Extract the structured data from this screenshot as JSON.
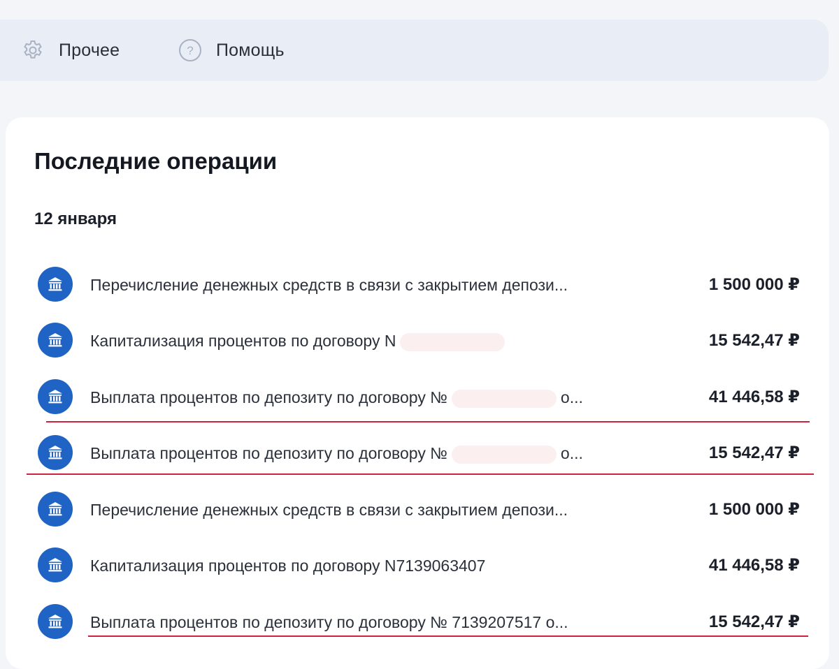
{
  "nav": {
    "other_label": "Прочее",
    "help_label": "Помощь",
    "icons": {
      "other": "gear-icon",
      "help": "help-circle-icon"
    }
  },
  "section": {
    "title": "Последние операции",
    "date": "12 января"
  },
  "operations": [
    {
      "prefix": "Перечисление денежных средств в связи с закрытием депози...",
      "suffix": "",
      "amount": "1 500 000 ₽",
      "redacted": false
    },
    {
      "prefix": "Капитализация процентов по договору N",
      "suffix": "",
      "amount": "15 542,47 ₽",
      "redacted": true
    },
    {
      "prefix": "Выплата процентов по депозиту по договору №",
      "suffix": "о...",
      "amount": "41 446,58 ₽",
      "redacted": true
    },
    {
      "prefix": "Выплата процентов по депозиту по договору №",
      "suffix": "о...",
      "amount": "15 542,47 ₽",
      "redacted": true
    },
    {
      "prefix": "Перечисление денежных средств в связи с закрытием депози...",
      "suffix": "",
      "amount": "1 500 000 ₽",
      "redacted": false
    },
    {
      "prefix": "Капитализация процентов по договору N7139063407",
      "suffix": "",
      "amount": "41 446,58 ₽",
      "redacted": false
    },
    {
      "prefix": "Выплата процентов по депозиту по договору № 7139207517 о...",
      "suffix": "",
      "amount": "15 542,47 ₽",
      "redacted": false
    }
  ],
  "colors": {
    "accent": "#1f63c4",
    "annotation": "#d0213f",
    "background": "#f3f5f9",
    "nav_background": "#e9edf5"
  }
}
